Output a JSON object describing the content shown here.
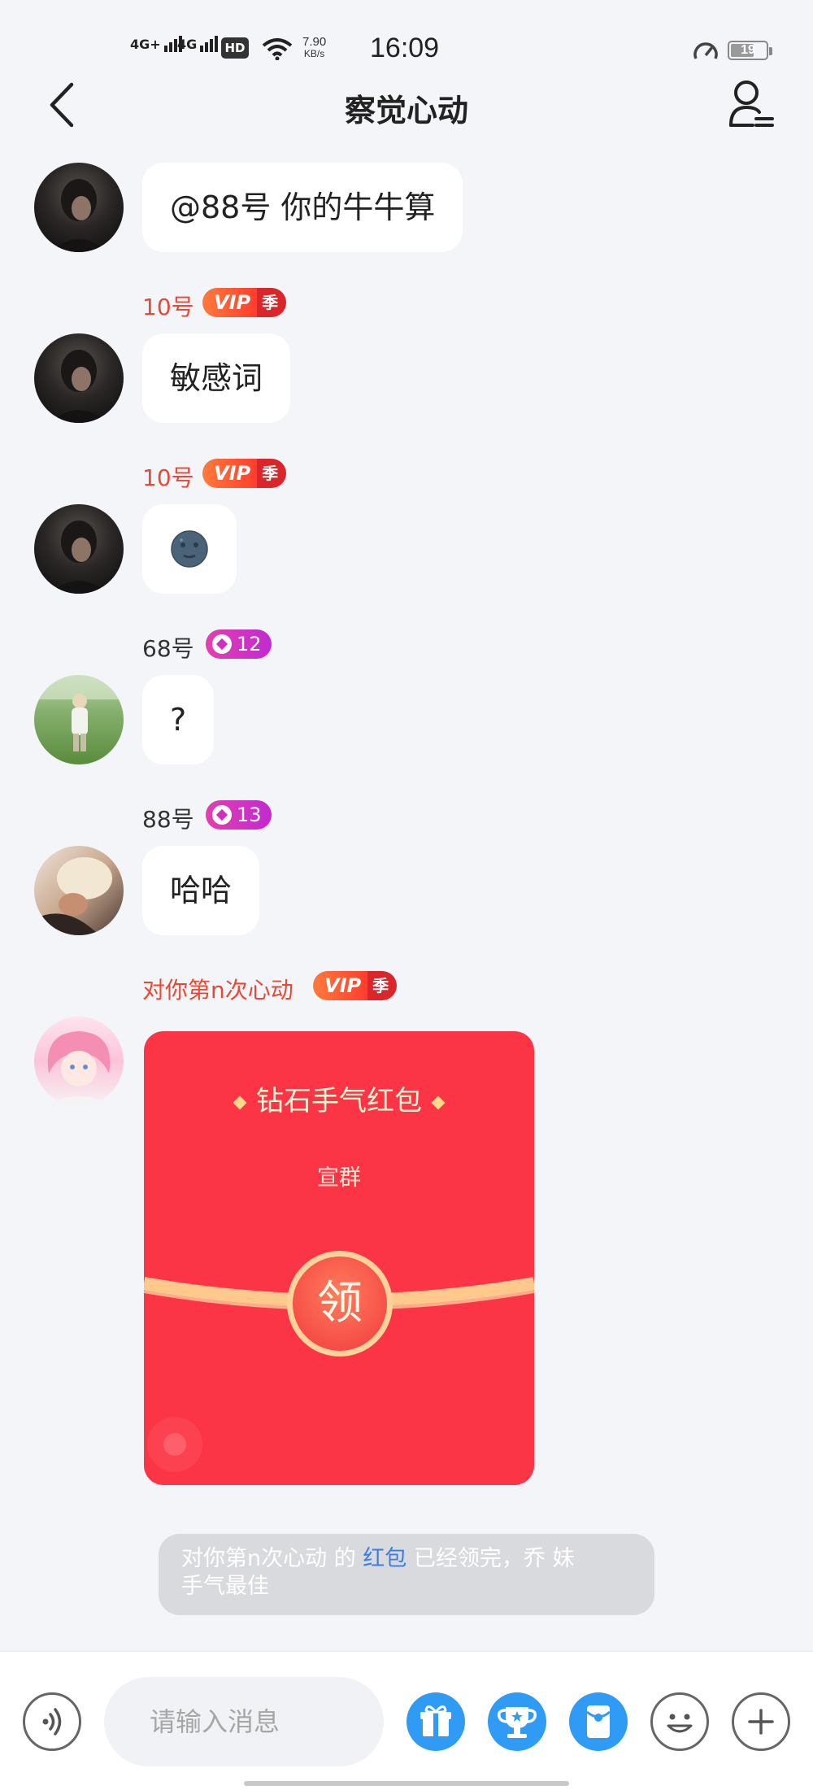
{
  "status_bar": {
    "sig1": "4G+",
    "sig2": "4G",
    "hd": "HD",
    "speed_value": "7.90",
    "speed_unit": "KB/s",
    "time": "16:09",
    "battery": "19"
  },
  "header": {
    "title": "察觉心动"
  },
  "messages": [
    {
      "sender": "",
      "text": "@88号 你的牛牛算"
    },
    {
      "sender": "10号",
      "badge": {
        "type": "vip",
        "label": "VIP",
        "suffix": "季"
      },
      "text": "敏感词"
    },
    {
      "sender": "10号",
      "badge": {
        "type": "vip",
        "label": "VIP",
        "suffix": "季"
      },
      "text": "🌚"
    },
    {
      "sender": "68号",
      "badge": {
        "type": "level",
        "value": "12"
      },
      "text": "?"
    },
    {
      "sender": "88号",
      "badge": {
        "type": "level",
        "value": "13"
      },
      "text": "哈哈"
    },
    {
      "sender": "对你第n次心动",
      "badge": {
        "type": "vip",
        "label": "VIP",
        "suffix": "季"
      }
    }
  ],
  "red_packet": {
    "title": "钻石手气红包",
    "sender": "宣群",
    "claim_label": "领"
  },
  "system_notice": {
    "name": "对你第n次心动",
    "de": " 的 ",
    "link": "红包",
    "rest": " 已经领完，乔 妹",
    "line2": "手气最佳"
  },
  "composer": {
    "placeholder": "请输入消息"
  },
  "icons": [
    "back-icon",
    "member-list-icon",
    "voice-icon",
    "gift-icon",
    "trophy-icon",
    "red-packet-icon",
    "emoji-icon",
    "plus-icon"
  ],
  "colors": {
    "page_bg": "#f4f5f9",
    "accent_red": "#fb3546",
    "nickname_red": "#e64a35",
    "link_blue": "#3a7de6",
    "tool_blue": "#2f9bf4"
  }
}
